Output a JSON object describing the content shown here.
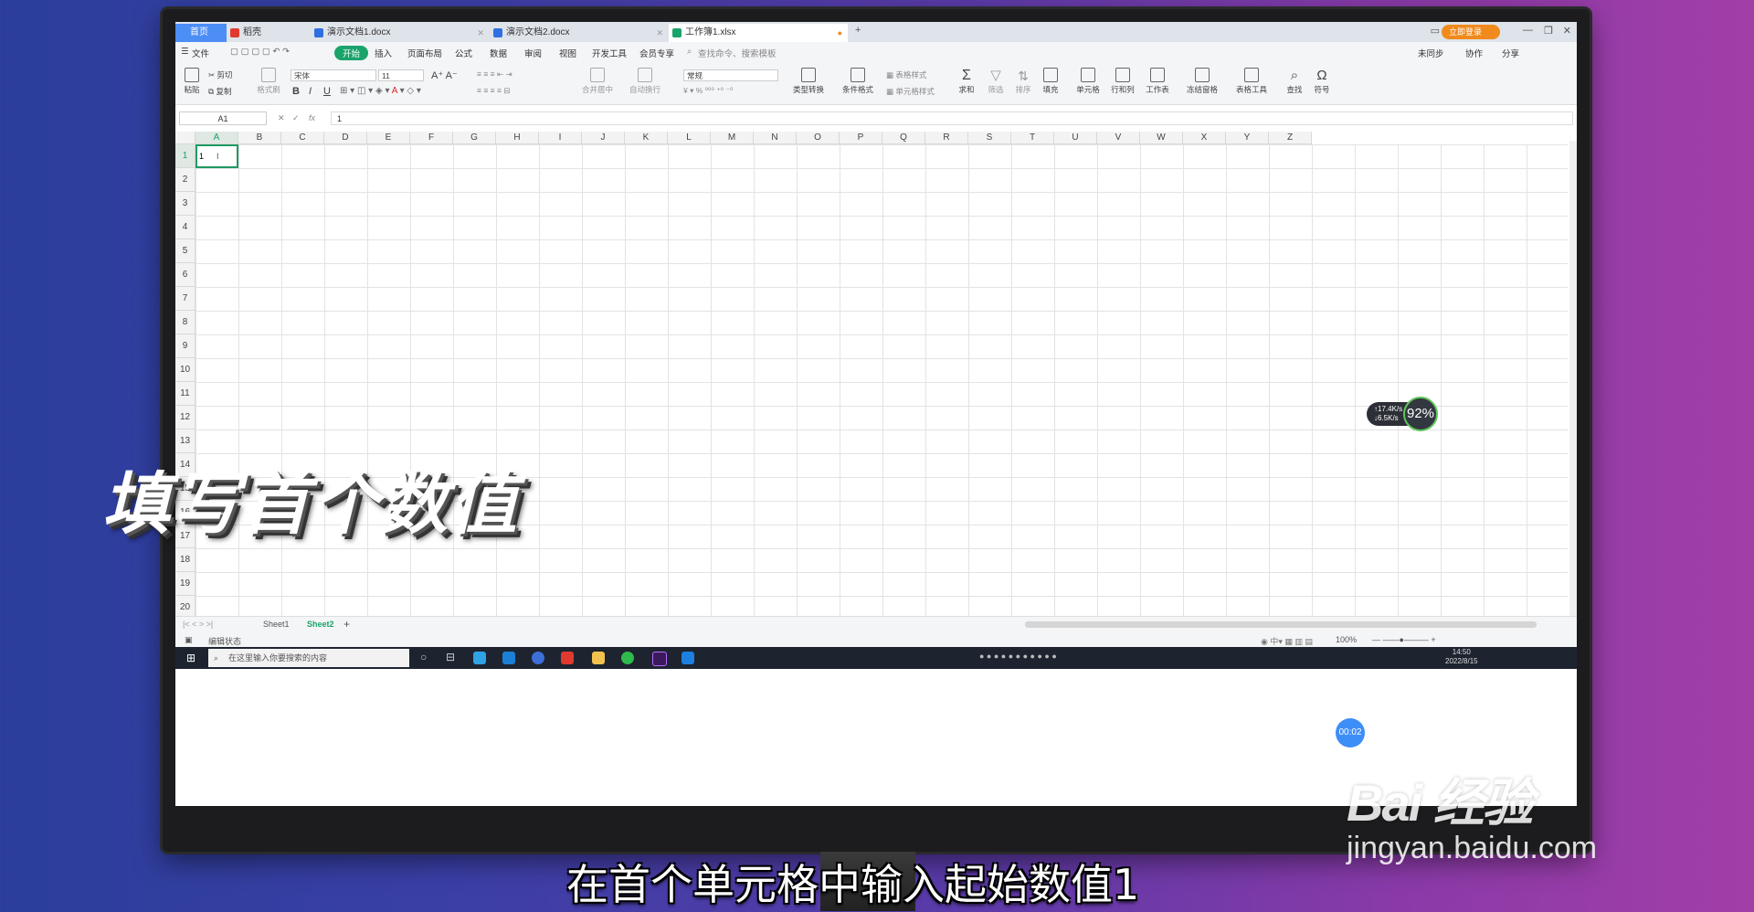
{
  "tabs": {
    "home": "首页",
    "t1": "稻壳",
    "t2": "演示文档1.docx",
    "t3": "演示文档2.docx",
    "t4": "工作簿1.xlsx",
    "login": "立即登录"
  },
  "menu": {
    "file": "文件",
    "start": "开始",
    "insert": "插入",
    "layout": "页面布局",
    "formula": "公式",
    "data": "数据",
    "review": "审阅",
    "view": "视图",
    "dev": "开发工具",
    "member": "会员专享",
    "search": "查找命令、搜索模板",
    "sync": "未同步",
    "collab": "协作",
    "share": "分享"
  },
  "ribbon": {
    "paste": "粘贴",
    "cut": "剪切",
    "copy": "复制",
    "format_painter": "格式刷",
    "font": "宋体",
    "size": "11",
    "merge": "合并居中",
    "wrap": "自动换行",
    "numfmt": "常规",
    "convert": "类型转换",
    "cond": "条件格式",
    "table_style": "表格样式",
    "cell_style": "单元格样式",
    "sum": "求和",
    "filter": "筛选",
    "sort": "排序",
    "fill": "填充",
    "cell": "单元格",
    "rowcol": "行和列",
    "sheet": "工作表",
    "freeze": "冻结窗格",
    "tools": "表格工具",
    "find": "查找",
    "symbol": "符号"
  },
  "formula_bar": {
    "name": "A1",
    "fx": "fx",
    "value": "1"
  },
  "columns": [
    "A",
    "B",
    "C",
    "D",
    "E",
    "F",
    "G",
    "H",
    "I",
    "J",
    "K",
    "L",
    "M",
    "N",
    "O",
    "P",
    "Q",
    "R",
    "S",
    "T",
    "U",
    "V",
    "W",
    "X",
    "Y",
    "Z"
  ],
  "rows": [
    "1",
    "2",
    "3",
    "4",
    "5",
    "6",
    "7",
    "8",
    "9",
    "10",
    "11",
    "12",
    "13",
    "14",
    "15",
    "16",
    "17",
    "18",
    "19",
    "20"
  ],
  "cell_a1": "1",
  "sheets": {
    "s1": "Sheet1",
    "s2": "Sheet2"
  },
  "status": {
    "mode": "编辑状态",
    "zoom": "100%"
  },
  "taskbar": {
    "search": "在这里输入你要搜索的内容",
    "time": "14:50",
    "date": "2022/8/15"
  },
  "speed": {
    "up": "↑17.4K/s",
    "down": "↓6.5K/s",
    "pct": "92%"
  },
  "timer": "00:02",
  "overlay_title": "填写首个数值",
  "subtitle": "在首个单元格中输入起始数值1",
  "watermark": {
    "logo": "Bai 经验",
    "url": "jingyan.baidu.com"
  }
}
